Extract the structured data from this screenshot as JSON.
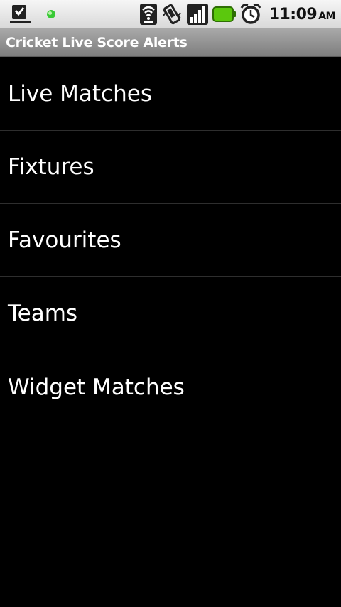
{
  "status_bar": {
    "time": "11:09",
    "ampm": "AM",
    "icons": [
      "download-complete-icon",
      "notification-led-icon",
      "wifi-icon",
      "vibrate-icon",
      "signal-strength-icon",
      "battery-icon",
      "alarm-clock-icon"
    ],
    "battery_color": "#5bc80d",
    "led_color": "#39c936"
  },
  "title_bar": {
    "title": "Cricket Live Score Alerts"
  },
  "menu": {
    "items": [
      {
        "label": "Live Matches"
      },
      {
        "label": "Fixtures"
      },
      {
        "label": "Favourites"
      },
      {
        "label": "Teams"
      },
      {
        "label": "Widget Matches"
      }
    ]
  }
}
